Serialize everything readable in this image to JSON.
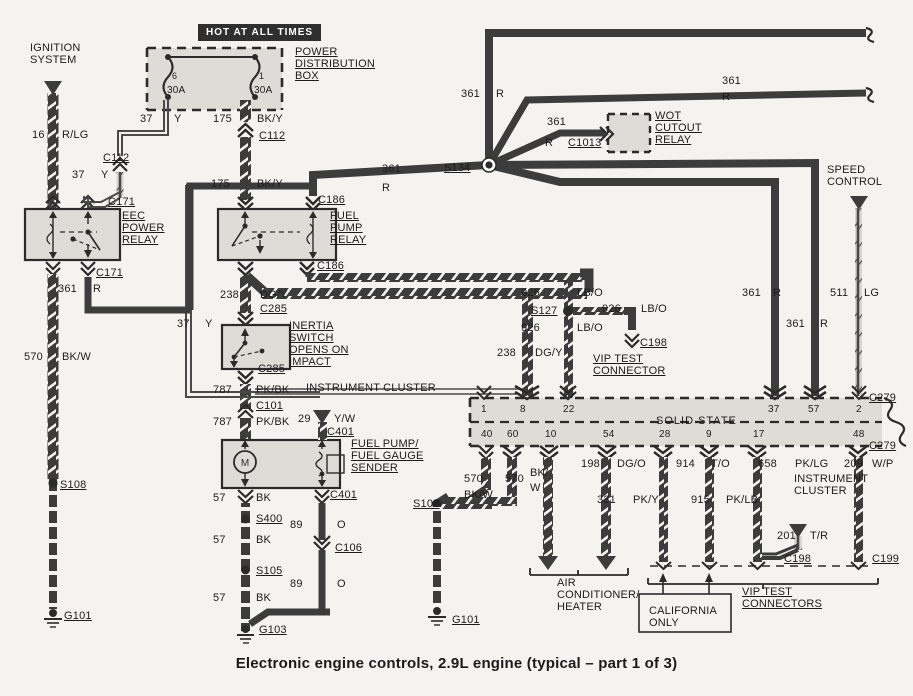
{
  "caption": "Electronic engine controls, 2.9L engine (typical – part 1 of 3)",
  "banners": {
    "hot_at_all_times": "HOT AT ALL TIMES"
  },
  "blocks": {
    "ignition_system": "IGNITION\nSYSTEM",
    "power_distribution_box": "POWER\nDISTRIBUTION\nBOX",
    "eec_power_relay": "EEC\nPOWER\nRELAY",
    "fuel_pump_relay": "FUEL\nPUMP\nRELAY",
    "wot_cutout_relay": "WOT\nCUTOUT\nRELAY",
    "inertia_switch": "INERTIA\nSWITCH\nOPENS ON\nIMPACT",
    "fuel_pump_sender": "FUEL PUMP/\nFUEL GAUGE\nSENDER",
    "speed_control": "SPEED\nCONTROL",
    "instrument_cluster_top": "INSTRUMENT CLUSTER",
    "solid_state": "SOLID STATE",
    "instrument_cluster_right": "INSTRUMENT\nCLUSTER",
    "vip_test_connector": "VIP TEST\nCONNECTOR",
    "vip_test_connectors": "VIP TEST\nCONNECTORS",
    "air_conditioner_heater": "AIR\nCONDITIONER/\nHEATER",
    "california_only": "CALIFORNIA\nONLY",
    "motor_symbol": "M"
  },
  "fuses": [
    {
      "cavity": "6",
      "rating": "30A"
    },
    {
      "cavity": "1",
      "rating": "30A"
    }
  ],
  "wires": [
    {
      "num": "16",
      "color": "R/LG"
    },
    {
      "num": "37",
      "color": "Y"
    },
    {
      "num": "175",
      "color": "BK/Y"
    },
    {
      "num": "37",
      "color": "Y"
    },
    {
      "num": "175",
      "color": "BK/Y"
    },
    {
      "num": "361",
      "color": "R"
    },
    {
      "num": "570",
      "color": "BK/W"
    },
    {
      "num": "37",
      "color": "Y"
    },
    {
      "num": "238",
      "color": "DG/Y"
    },
    {
      "num": "787",
      "color": "PK/BK"
    },
    {
      "num": "787",
      "color": "PK/BK"
    },
    {
      "num": "29",
      "color": "Y/W"
    },
    {
      "num": "57",
      "color": "BK"
    },
    {
      "num": "57",
      "color": "BK"
    },
    {
      "num": "57",
      "color": "BK"
    },
    {
      "num": "89",
      "color": "O"
    },
    {
      "num": "89",
      "color": "O"
    },
    {
      "num": "361",
      "color": "R"
    },
    {
      "num": "361",
      "color": "R"
    },
    {
      "num": "361",
      "color": "R"
    },
    {
      "num": "361",
      "color": "R"
    },
    {
      "num": "361",
      "color": "R"
    },
    {
      "num": "926",
      "color": "LB/O"
    },
    {
      "num": "926",
      "color": "LB/O"
    },
    {
      "num": "926",
      "color": "LB/O"
    },
    {
      "num": "238",
      "color": "DG/Y"
    },
    {
      "num": "511",
      "color": "LG"
    },
    {
      "num": "570",
      "color": "BK/W"
    },
    {
      "num": "570",
      "color": "BK/W"
    },
    {
      "num": "198",
      "color": "DG/O"
    },
    {
      "num": "331",
      "color": "PK/Y"
    },
    {
      "num": "914",
      "color": "T/O"
    },
    {
      "num": "915",
      "color": "PK/LB"
    },
    {
      "num": "658",
      "color": "PK/LG"
    },
    {
      "num": "209",
      "color": "W/P"
    },
    {
      "num": "201",
      "color": "T/R"
    }
  ],
  "wire_labels": {
    "w16": "16",
    "c16": "R/LG",
    "w37a": "37",
    "c37a": "Y",
    "w175a": "175",
    "c175a": "BK/Y",
    "w37b": "37",
    "c37b": "Y",
    "w175b": "175",
    "c175b": "BK/Y",
    "w361a": "361",
    "c361a": "R",
    "w570a": "570",
    "c570a": "BK/W",
    "w37c": "37",
    "c37c": "Y",
    "w238a": "238",
    "c238a": "DG/Y",
    "w787a": "787",
    "c787a": "PK/BK",
    "w787b": "787",
    "c787b": "PK/BK",
    "w29": "29",
    "c29": "Y/W",
    "w57a": "57",
    "c57a": "BK",
    "w57b": "57",
    "c57b": "BK",
    "w57c": "57",
    "c57c": "BK",
    "w89a": "89",
    "c89a": "O",
    "w89b": "89",
    "c89b": "O",
    "w361b": "361",
    "c361b": "R",
    "w361c": "361",
    "c361c": "R",
    "w361d": "361",
    "c361d": "R",
    "w361e": "361",
    "c361e": "R",
    "w361f": "361",
    "c361f": "R",
    "w926a": "926",
    "c926a": "LB/O",
    "w926b": "926",
    "c926b": "LB/O",
    "w926c": "926",
    "c926c": "LB/O",
    "w238b": "238",
    "c238b": "DG/Y",
    "w511": "511",
    "c511": "LG",
    "w570b": "570",
    "c570b": "BK/W",
    "w570c": "570",
    "c570c": "570",
    "w570d": "BK/\nW",
    "w198": "198",
    "c198w": "DG/O",
    "w331": "331",
    "c331": "PK/Y",
    "w914": "914",
    "c914": "T/O",
    "w915": "915",
    "c915": "PK/LB",
    "w658": "658",
    "c658": "PK/LG",
    "w209": "209",
    "c209": "W/P",
    "w201": "201",
    "c201": "T/R"
  },
  "connectors": [
    "C112",
    "C112",
    "C171",
    "C171",
    "C186",
    "C186",
    "C285",
    "C285",
    "C101",
    "C401",
    "C401",
    "C106",
    "C1013",
    "C198",
    "C279",
    "C279",
    "C198",
    "C199"
  ],
  "connector_labels": {
    "c112a": "C112",
    "c112b": "C112",
    "c171a": "C171",
    "c171b": "C171",
    "c186a": "C186",
    "c186b": "C186",
    "c285a": "C285",
    "c285b": "C285",
    "c101": "C101",
    "c401a": "C401",
    "c401b": "C401",
    "c106": "C106",
    "c1013": "C1013",
    "c198a": "C198",
    "c279a": "C279",
    "c279b": "C279",
    "c198b": "C198",
    "c199": "C199"
  },
  "splices": {
    "s134": "S134",
    "s127": "S127",
    "s108a": "S108",
    "s108b": "S108",
    "s400": "S400",
    "s105": "S105"
  },
  "grounds": {
    "g101a": "G101",
    "g103": "G103",
    "g101b": "G101"
  },
  "cluster_pins": {
    "top": [
      "1",
      "8",
      "22",
      "37",
      "57",
      "2"
    ],
    "bottom": [
      "40",
      "60",
      "10",
      "54",
      "28",
      "9",
      "17",
      "48"
    ]
  },
  "colors": {
    "background": "#f4f3ef",
    "ink": "#2b2b2b",
    "heavy_wire": "#3a3a3a",
    "box_fill": "#dedcd7",
    "banner_bg": "#2f2f2f",
    "banner_text": "#ffffff"
  }
}
